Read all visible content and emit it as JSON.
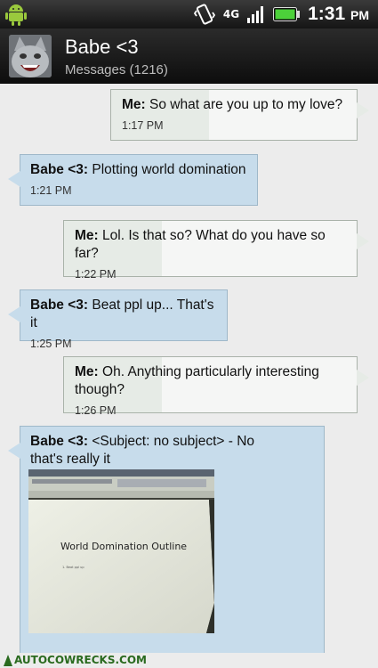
{
  "status_bar": {
    "network": "4G",
    "time": "1:31",
    "ampm": "PM"
  },
  "contact": {
    "name": "Babe <3",
    "messages_count": "Messages (1216)"
  },
  "messages": [
    {
      "sender": "Me:",
      "text": "So what are you up to my love?",
      "time": "1:17 PM",
      "direction": "outgoing"
    },
    {
      "sender": "Babe <3:",
      "text": "Plotting world domination",
      "time": "1:21 PM",
      "direction": "incoming"
    },
    {
      "sender": "Me:",
      "text": "Lol. Is that so? What do you have so far?",
      "time": "1:22 PM",
      "direction": "outgoing"
    },
    {
      "sender": "Babe <3:",
      "text": "Beat ppl up... That's it",
      "time": "1:25 PM",
      "direction": "incoming"
    },
    {
      "sender": "Me:",
      "text": "Oh. Anything particularly interesting though?",
      "time": "1:26 PM",
      "direction": "outgoing"
    },
    {
      "sender": "Babe <3:",
      "text": "<Subject: no subject> - No that's really it",
      "time": "",
      "direction": "incoming",
      "attachment": {
        "document_title": "World Domination Outline",
        "document_line": "1. Beat ppl up"
      }
    }
  ],
  "watermark": "AUTOCOWRECKS.COM",
  "colors": {
    "incoming_bubble": "#c7dceb",
    "outgoing_bubble": "#e6ebe6",
    "thread_bg": "#ececec",
    "battery": "#4cd13a"
  }
}
